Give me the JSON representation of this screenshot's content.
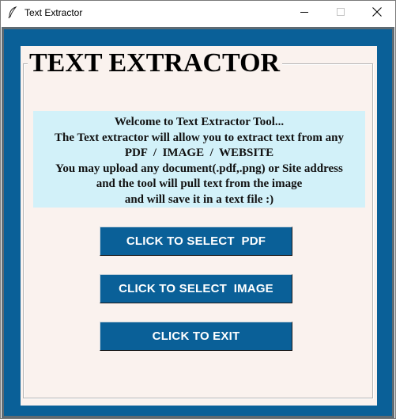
{
  "window": {
    "title": "Text Extractor",
    "icon": "feather-icon",
    "controls": [
      "minimize-icon",
      "maximize-icon",
      "close-icon"
    ]
  },
  "panel": {
    "group_title": "TEXT EXTRACTOR",
    "info_lines": [
      "Welcome to Text Extractor Tool...",
      "The Text extractor will allow you to extract text from any",
      "PDF  /  IMAGE  /  WEBSITE",
      "You may upload any document(.pdf,.png) or Site address",
      "and the tool will pull text from the image",
      "and will save it in a text file :)"
    ]
  },
  "buttons": {
    "select_pdf": "CLICK TO SELECT  PDF",
    "select_image": "CLICK TO SELECT  IMAGE",
    "exit": "CLICK TO EXIT"
  },
  "colors": {
    "frame_blue": "#0a6098",
    "panel_cream": "#faf2ee",
    "info_bg": "#d2f1f9",
    "button_bg": "#0a6098",
    "button_text": "#ffffff"
  }
}
